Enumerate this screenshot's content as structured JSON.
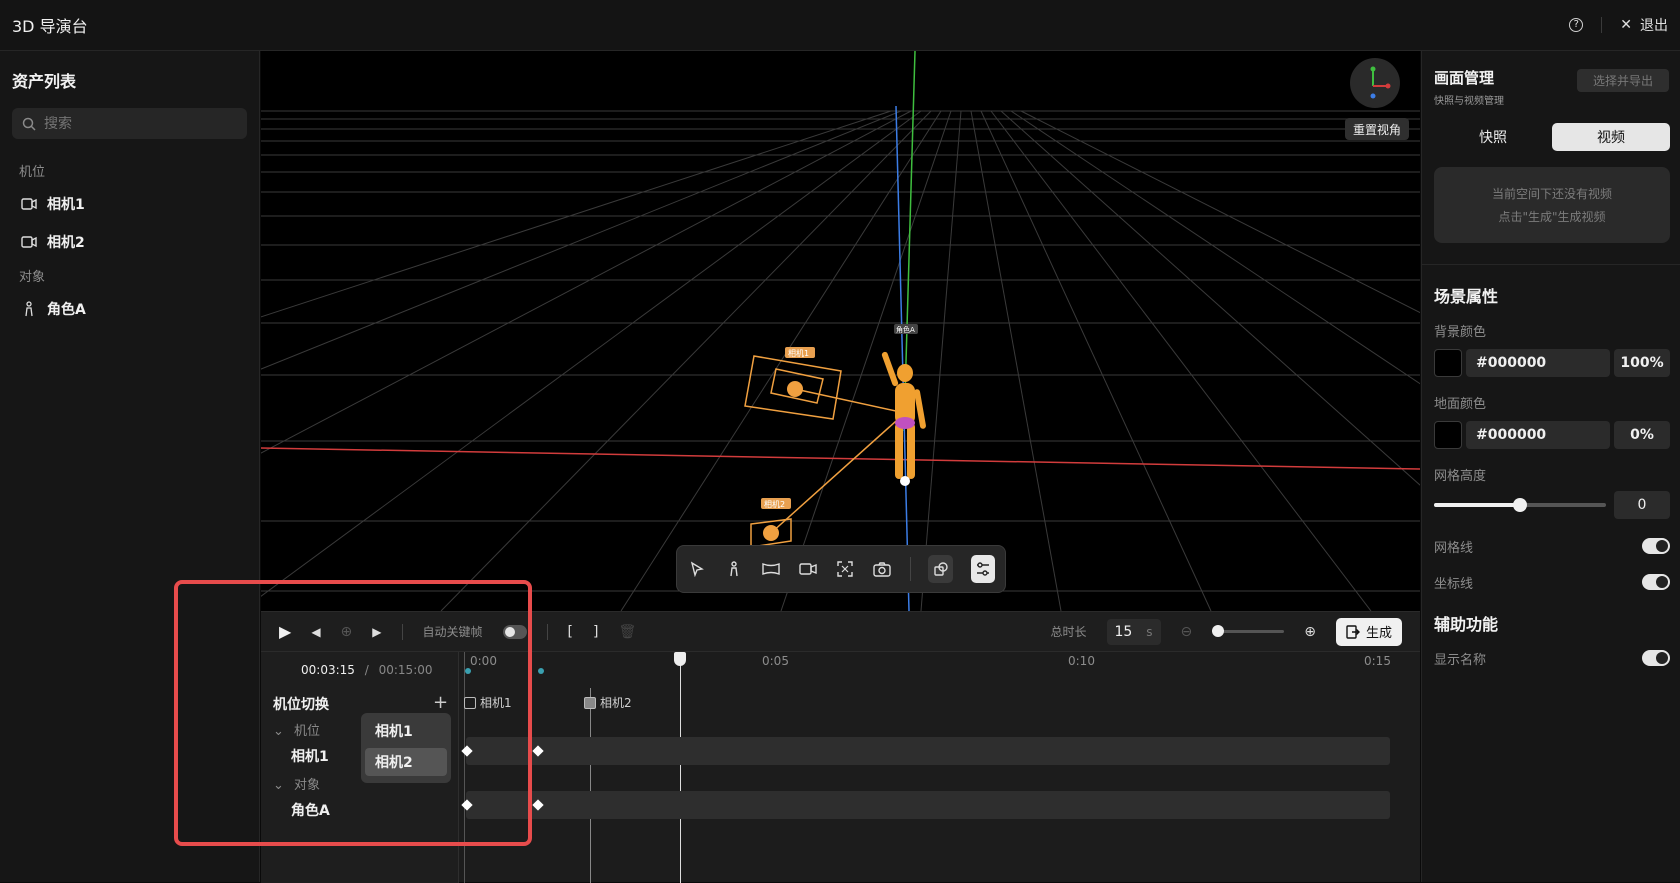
{
  "app": {
    "title": "3D 导演台",
    "help": "?",
    "exit_label": "退出"
  },
  "assets": {
    "title": "资产列表",
    "search_placeholder": "搜索",
    "groups": [
      {
        "label": "机位",
        "items": [
          "相机1",
          "相机2"
        ]
      },
      {
        "label": "对象",
        "items": [
          "角色A"
        ]
      }
    ]
  },
  "viewport": {
    "reset_view_label": "重置视角",
    "labels": {
      "cam1": "相机1",
      "cam2": "相机2",
      "role": "角色A"
    },
    "tools": [
      "select-icon",
      "person-icon",
      "plane-icon",
      "camera-icon",
      "focus-icon",
      "snapshot-icon",
      "layers-icon",
      "settings-sliders-icon"
    ]
  },
  "timeline": {
    "auto_keyframe_label": "自动关键帧",
    "range_start": "[",
    "range_end": "]",
    "total_label": "总时长",
    "total_value": "15",
    "total_unit": "s",
    "generate_label": "生成",
    "current_time": "00:03:15",
    "time_sep": "/",
    "total_time": "00:15:00",
    "section_title": "机位切换",
    "add": "+",
    "ruler": [
      "0:00",
      "0:05",
      "0:10",
      "0:15"
    ],
    "tree": {
      "cameras_group": "机位",
      "camera_row": "相机1",
      "objects_group": "对象",
      "object_row": "角色A"
    },
    "dropdown": {
      "options": [
        "相机1",
        "相机2"
      ],
      "selected": "相机2"
    },
    "markers": [
      "相机1",
      "相机2"
    ]
  },
  "right_panel": {
    "title": "画面管理",
    "subtitle": "快照与视频管理",
    "export_button": "选择并导出",
    "tabs": [
      "快照",
      "视频"
    ],
    "active_tab": "视频",
    "empty_line1": "当前空间下还没有视频",
    "empty_line2": "点击\"生成\"生成视频",
    "scene_title": "场景属性",
    "bg_label": "背景颜色",
    "bg_hex": "#000000",
    "bg_opacity": "100%",
    "ground_label": "地面颜色",
    "ground_hex": "#000000",
    "ground_opacity": "0%",
    "grid_height_label": "网格高度",
    "grid_height_value": "0",
    "grid_height_fraction": 0.5,
    "grid_lines_label": "网格线",
    "axis_lines_label": "坐标线",
    "assist_title": "辅助功能",
    "show_names_label": "显示名称"
  }
}
